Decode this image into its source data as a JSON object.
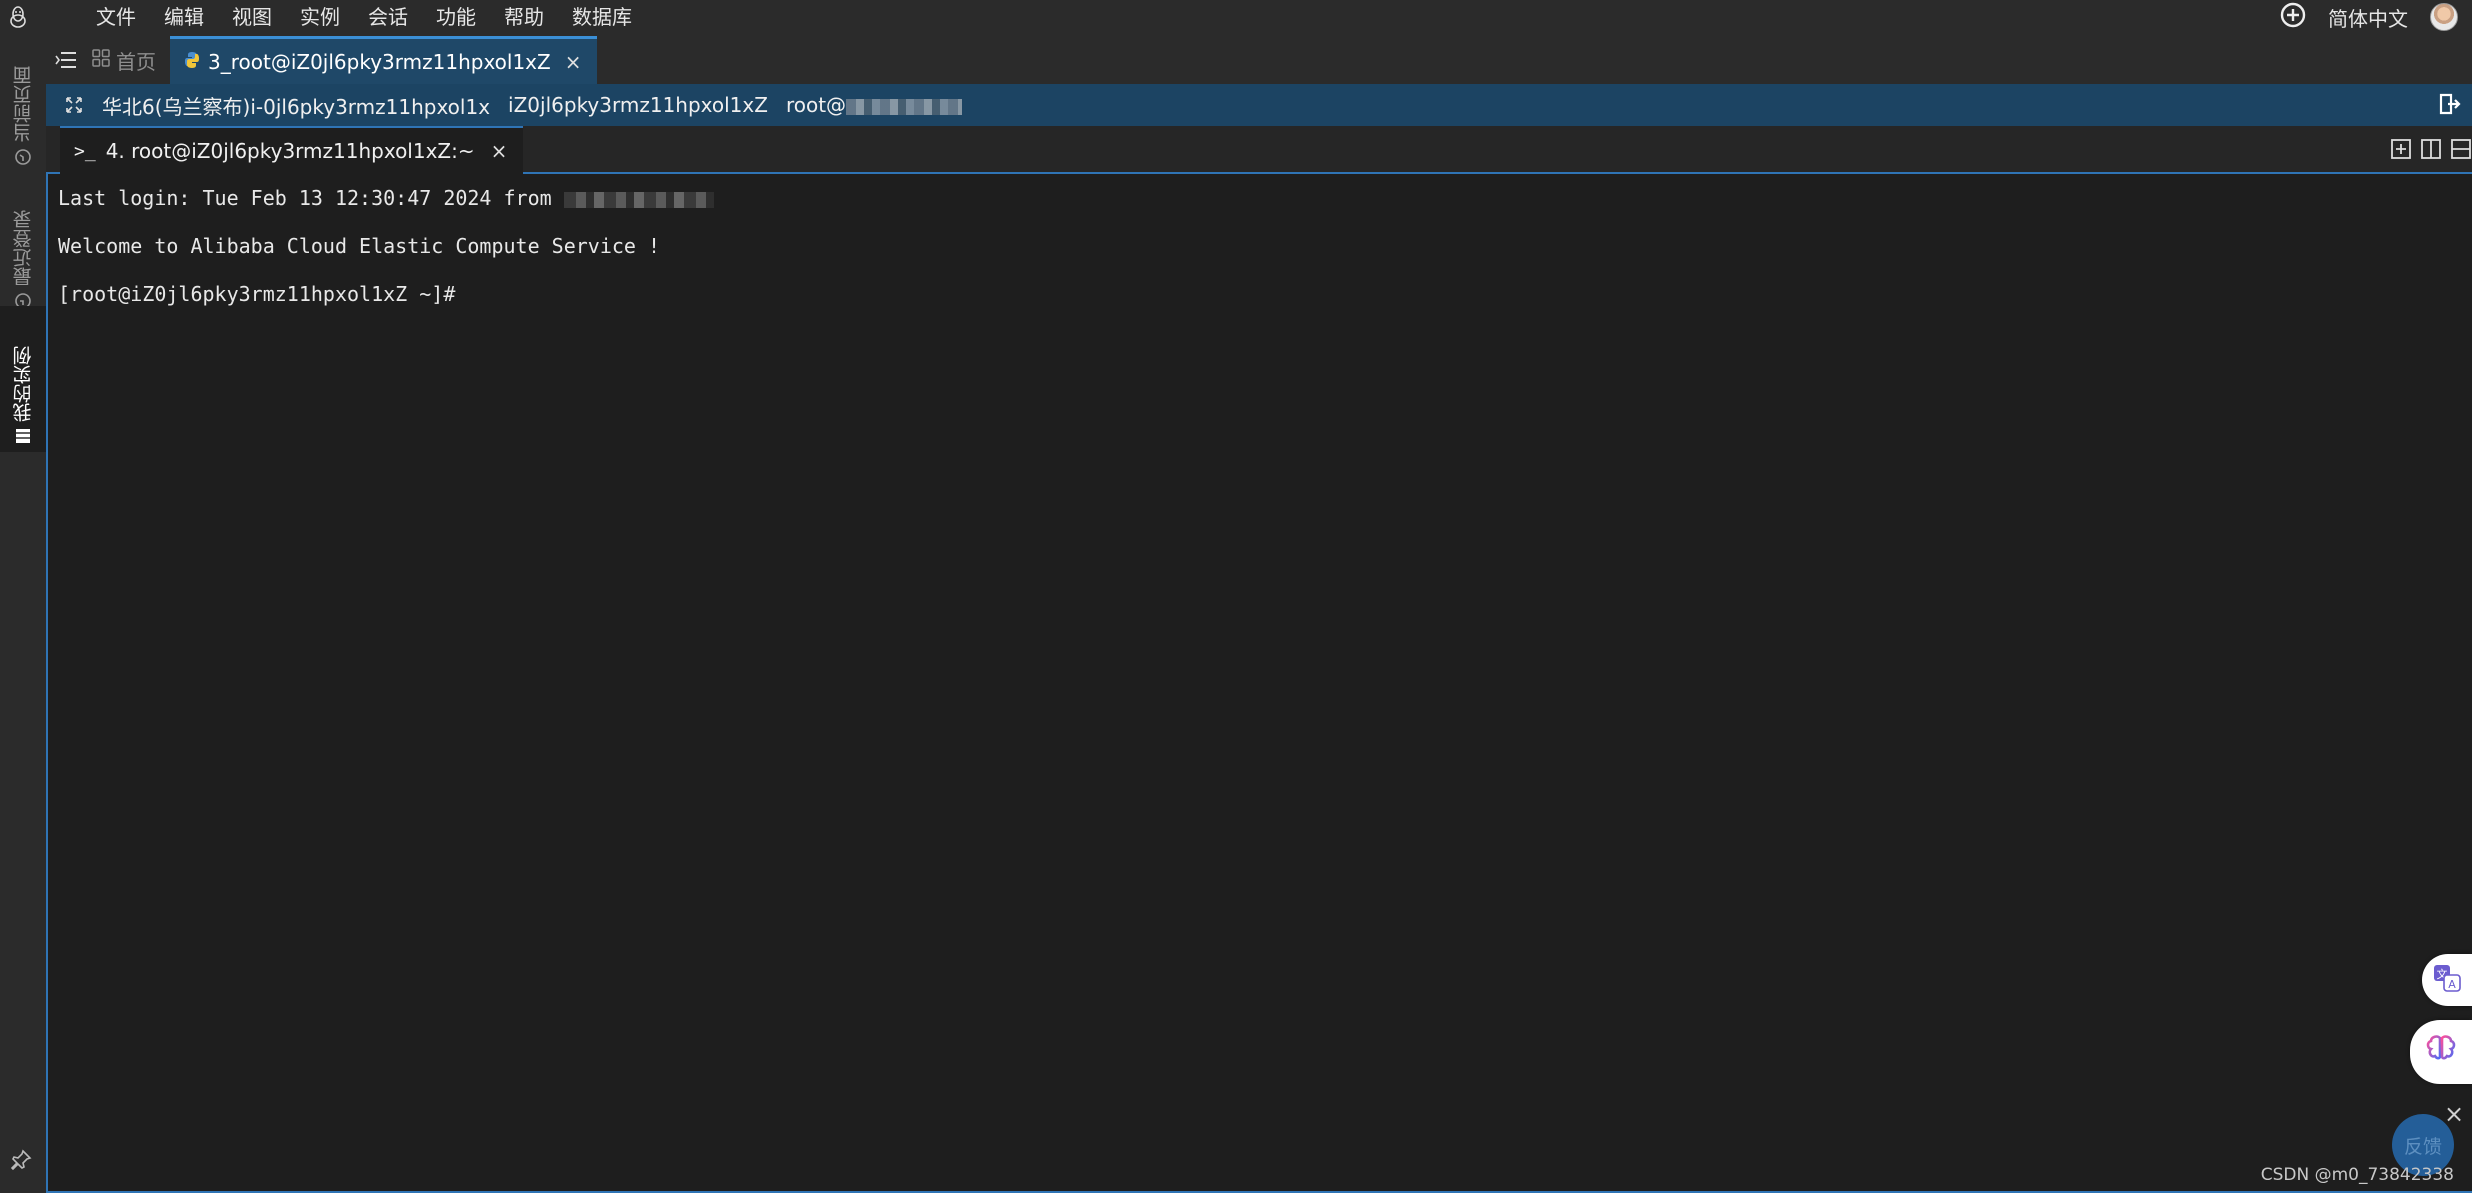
{
  "menubar": {
    "items": [
      "文件",
      "编辑",
      "视图",
      "实例",
      "会话",
      "功能",
      "帮助",
      "数据库"
    ],
    "language": "简体中文"
  },
  "siderail": {
    "current_page": "当前页面",
    "recent_logins": "最近登录",
    "my_instances": "我的实例"
  },
  "tabs": {
    "home": "首页",
    "session": "3_root@iZ0jl6pky3rmz11hpxol1xZ",
    "close": "×"
  },
  "infobar": {
    "region": "华北6(乌兰察布)i-0jl6pky3rmz11hpxol1x",
    "hostname": "iZ0jl6pky3rmz11hpxol1xZ",
    "user": "root@"
  },
  "terminal_tab": {
    "label": "4. root@iZ0jl6pky3rmz11hpxol1xZ:~",
    "close": "×"
  },
  "terminal": {
    "line1": "Last login: Tue Feb 13 12:30:47 2024 from ",
    "line2": "Welcome to Alibaba Cloud Elastic Compute Service !",
    "line3": "[root@iZ0jl6pky3rmz11hpxol1xZ ~]#"
  },
  "widgets": {
    "feedback": "反馈",
    "close": "×"
  },
  "watermark": "CSDN @m0_73842338",
  "colors": {
    "accent": "#2f74b5",
    "infobar": "#1c4463",
    "active_tab": "#1f4868"
  }
}
